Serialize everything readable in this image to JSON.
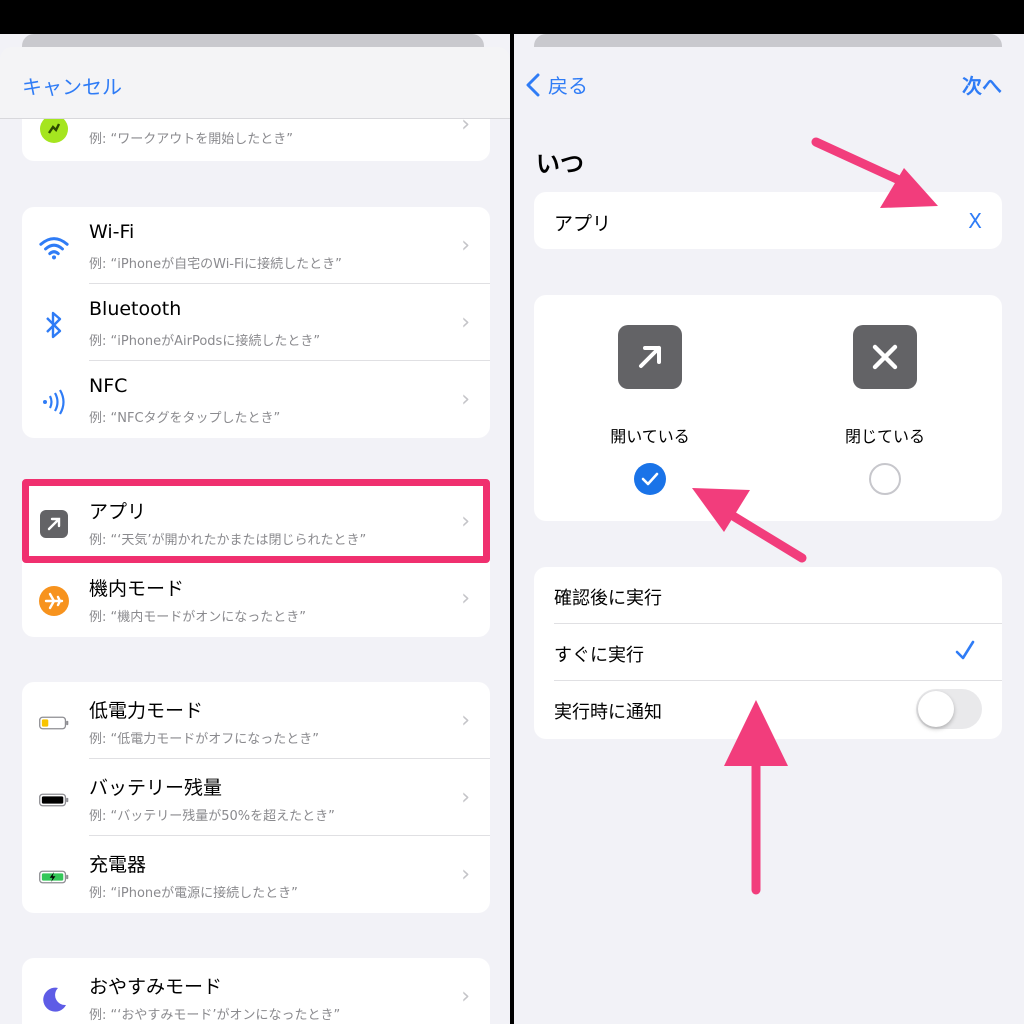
{
  "left": {
    "cancel_label": "キャンセル",
    "partial_row_sub": "例: “ワークアウトを開始したとき”",
    "connectivity": [
      {
        "title": "Wi-Fi",
        "sub": "例: “iPhoneが自宅のWi-Fiに接続したとき”",
        "icon": "wifi-icon"
      },
      {
        "title": "Bluetooth",
        "sub": "例: “iPhoneがAirPodsに接続したとき”",
        "icon": "bluetooth-icon"
      },
      {
        "title": "NFC",
        "sub": "例: “NFCタグをタップしたとき”",
        "icon": "nfc-icon"
      }
    ],
    "apps": [
      {
        "title": "アプリ",
        "sub": "例: “‘天気’が開かれたかまたは閉じられたとき”",
        "icon": "app-arrow-icon"
      },
      {
        "title": "機内モード",
        "sub": "例: “機内モードがオンになったとき”",
        "icon": "airplane-icon"
      }
    ],
    "power": [
      {
        "title": "低電力モード",
        "sub": "例: “低電力モードがオフになったとき”",
        "icon": "low-battery-icon"
      },
      {
        "title": "バッテリー残量",
        "sub": "例: “バッテリー残量が50%を超えたとき”",
        "icon": "battery-icon"
      },
      {
        "title": "充電器",
        "sub": "例: “iPhoneが電源に接続したとき”",
        "icon": "charging-icon"
      }
    ],
    "focus": [
      {
        "title": "おやすみモード",
        "sub": "例: “‘おやすみモード’がオンになったとき”",
        "icon": "moon-icon"
      }
    ]
  },
  "right": {
    "back_label": "戻る",
    "next_label": "次へ",
    "when_title": "いつ",
    "app_label": "アプリ",
    "app_value": "X",
    "open_label": "開いている",
    "closed_label": "閉じている",
    "open_selected": true,
    "run_rows": {
      "confirm": "確認後に実行",
      "immediately": "すぐに実行",
      "notify": "実行時に通知"
    },
    "notify_on": false
  },
  "colors": {
    "accent": "#2f7cf6",
    "highlight": "#f0306f",
    "arrow": "#f23d7c"
  }
}
